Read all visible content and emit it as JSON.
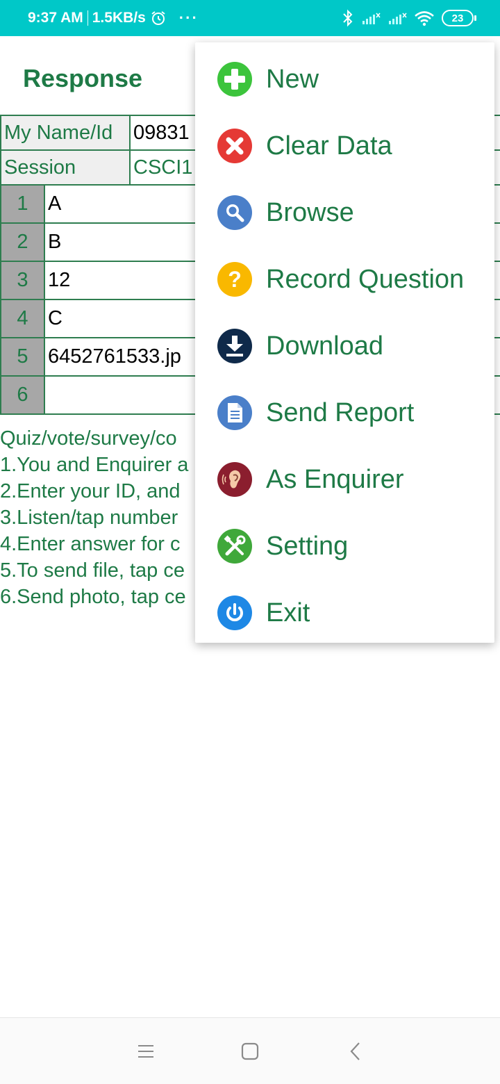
{
  "status_bar": {
    "time": "9:37 AM",
    "speed": "1.5KB/s",
    "dots": "···",
    "battery": "23",
    "icons": [
      "alarm-icon",
      "bluetooth-icon",
      "signal-icon",
      "signal-icon",
      "wifi-icon",
      "battery-icon"
    ]
  },
  "header": {
    "title": "Response"
  },
  "table": {
    "name_label": "My Name/Id",
    "name_value": "09831",
    "session_label": "Session",
    "session_value": "CSCI1",
    "rows": [
      {
        "num": "1",
        "answer": "A"
      },
      {
        "num": "2",
        "answer": "B"
      },
      {
        "num": "3",
        "answer": "12"
      },
      {
        "num": "4",
        "answer": "C"
      },
      {
        "num": "5",
        "answer": "6452761533.jp"
      },
      {
        "num": "6",
        "answer": ""
      }
    ]
  },
  "instructions": [
    "Quiz/vote/survey/co",
    "1.You and Enquirer a",
    "2.Enter your ID, and",
    "3.Listen/tap number",
    "4.Enter answer for c",
    "5.To send file, tap ce",
    "6.Send photo, tap ce"
  ],
  "menu": {
    "items": [
      {
        "label": "New",
        "icon": "plus-icon",
        "color": "#3cc43c"
      },
      {
        "label": "Clear Data",
        "icon": "close-icon",
        "color": "#e53935"
      },
      {
        "label": "Browse",
        "icon": "search-icon",
        "color": "#4a7fc9"
      },
      {
        "label": "Record Question",
        "icon": "question-icon",
        "color": "#f9b800"
      },
      {
        "label": "Download",
        "icon": "download-icon",
        "color": "#0f2a4a"
      },
      {
        "label": "Send Report",
        "icon": "document-icon",
        "color": "#4a7fc9"
      },
      {
        "label": "As Enquirer",
        "icon": "ear-icon",
        "color": "#8b1e2e"
      },
      {
        "label": "Setting",
        "icon": "tools-icon",
        "color": "#3fa83a"
      },
      {
        "label": "Exit",
        "icon": "power-icon",
        "color": "#1e88e5"
      }
    ]
  },
  "nav_bar": {
    "icons": [
      "menu-icon",
      "home-icon",
      "back-icon"
    ]
  },
  "colors": {
    "accent": "#1e7a46",
    "status_bar": "#00c8c8"
  }
}
